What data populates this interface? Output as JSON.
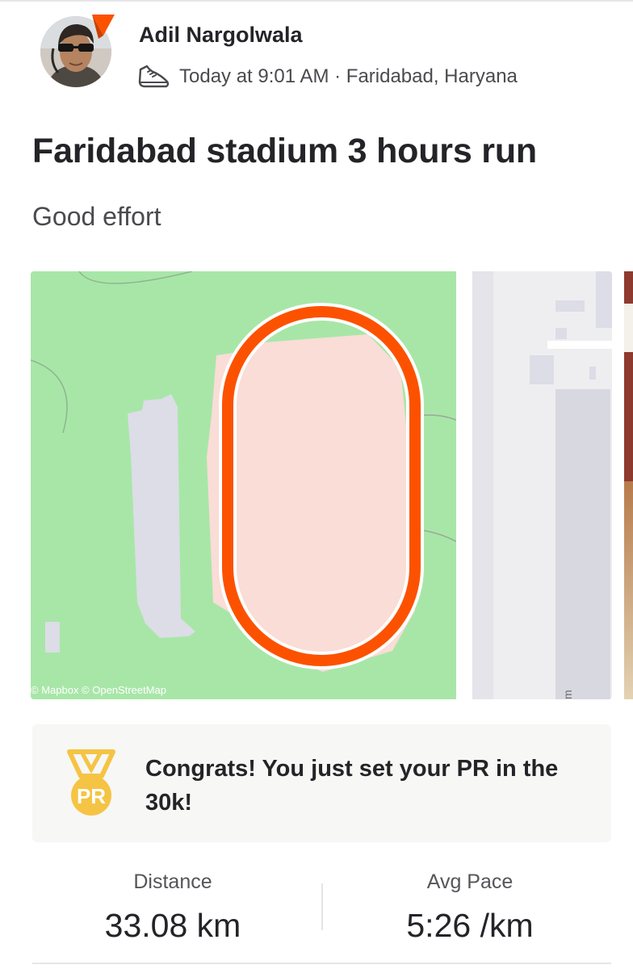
{
  "athlete": {
    "name": "Adil Nargolwala",
    "avatar_icon": "athlete-avatar",
    "badge_icon": "subscriber-badge-icon"
  },
  "activity": {
    "sport_icon": "run-shoe-icon",
    "meta": "Today at 9:01 AM · Faridabad, Haryana",
    "title": "Faridabad stadium 3 hours run",
    "description": "Good effort"
  },
  "map": {
    "attribution": "© Mapbox © OpenStreetMap",
    "route_color": "#fc5200",
    "park_color": "#a8e6a8",
    "stadium_color": "#f9ddd6"
  },
  "achievement": {
    "icon": "pr-medal-icon",
    "medal_label": "PR",
    "text": "Congrats! You just set your PR in the 30k!"
  },
  "stats": {
    "distance": {
      "label": "Distance",
      "value": "33.08 km"
    },
    "pace": {
      "label": "Avg Pace",
      "value": "5:26 /km"
    }
  },
  "colors": {
    "accent": "#fc5200",
    "medal_gold": "#f5c444",
    "text_primary": "#242428"
  }
}
